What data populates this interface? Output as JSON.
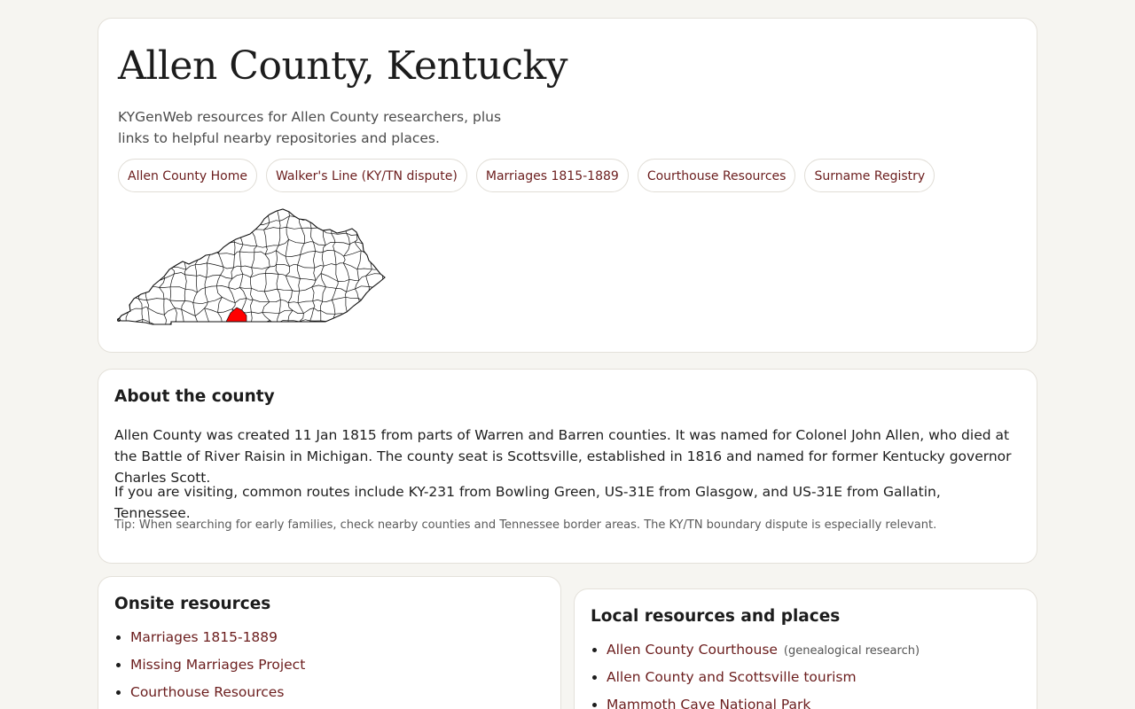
{
  "header": {
    "title": "Allen County, Kentucky",
    "lede": "KYGenWeb resources for Allen County researchers, plus links to helpful nearby repositories and places.",
    "nav": [
      "Allen County Home",
      "Walker's Line (KY/TN dispute)",
      "Marriages 1815-1889",
      "Courthouse Resources",
      "Surname Registry"
    ]
  },
  "map": {
    "highlight_color": "#ff0000",
    "outline_color": "#111111"
  },
  "about": {
    "heading": "About the county",
    "p1": "Allen County was created 11 Jan 1815 from parts of Warren and Barren counties. It was named for Colonel John Allen, who died at the Battle of River Raisin in Michigan. The county seat is Scottsville, established in 1816 and named for former Kentucky governor Charles Scott.",
    "p2": "If you are visiting, common routes include KY-231 from Bowling Green, US-31E from Glasgow, and US-31E from Gallatin, Tennessee.",
    "tip": "Tip: When searching for early families, check nearby counties and Tennessee border areas. The KY/TN boundary dispute is especially relevant."
  },
  "onsite": {
    "heading": "Onsite resources",
    "items": [
      "Marriages 1815-1889",
      "Missing Marriages Project",
      "Courthouse Resources"
    ]
  },
  "local": {
    "heading": "Local resources and places",
    "items": [
      {
        "label": "Allen County Courthouse",
        "note": "(genealogical research)"
      },
      {
        "label": "Allen County and Scottsville tourism",
        "note": ""
      },
      {
        "label": "Mammoth Cave National Park",
        "note": ""
      }
    ]
  },
  "colors": {
    "link": "#6b1d1d",
    "background": "#f6f5f1",
    "card": "#ffffff"
  }
}
